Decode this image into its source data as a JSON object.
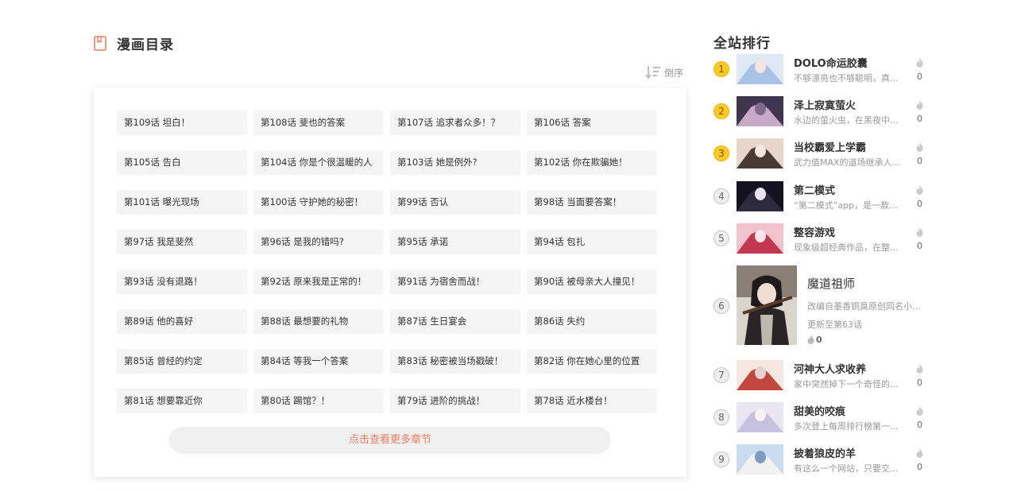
{
  "catalog": {
    "title": "漫画目录",
    "sort_label": "倒序",
    "more_label": "点击查看更多章节",
    "chapters": [
      "第109话 坦白！",
      "第108话 斐也的答案",
      "第107话 追求者众多！？",
      "第106话 答案",
      "第105话 告白",
      "第104话 你是个很温暖的人",
      "第103话 她是例外?",
      "第102话 你在欺骗她！",
      "第101话 曝光现场",
      "第100话 守护她的秘密！",
      "第99话 否认",
      "第98话 当面要答案！",
      "第97话 我是斐然",
      "第96话 是我的错吗?",
      "第95话 承诺",
      "第94话 包扎",
      "第93话 没有退路！",
      "第92话 原来我是正常的！",
      "第91话 为宿舍而战！",
      "第90话 被母亲大人撞见！",
      "第89话 他的喜好",
      "第88话 最想要的礼物",
      "第87话 生日宴会",
      "第86话 失约",
      "第85话 曾经的约定",
      "第84话 等我一个答案",
      "第83话 秘密被当场戳破！",
      "第82话 你在她心里的位置",
      "第81话 想要靠近你",
      "第80话 踢馆？！",
      "第79话 进阶的挑战！",
      "第78话 近水楼台！"
    ]
  },
  "ranking": {
    "title": "全站排行",
    "items": [
      {
        "rank": "1",
        "name": "DOLO命运胶囊",
        "desc": "不够漂亮也不够聪明，真...",
        "heat": "0"
      },
      {
        "rank": "2",
        "name": "泽上寂寞萤火",
        "desc": "水边的萤火虫，在黑夜中...",
        "heat": "0"
      },
      {
        "rank": "3",
        "name": "当校霸爱上学霸",
        "desc": "武力值MAX的道场继承人...",
        "heat": "0"
      },
      {
        "rank": "4",
        "name": "第二模式",
        "desc": "“第二模式”app，是一款...",
        "heat": "0"
      },
      {
        "rank": "5",
        "name": "整容游戏",
        "desc": "现象级超经典作品，在整...",
        "heat": "0"
      }
    ],
    "featured": {
      "rank": "6",
      "name": "魔道祖师",
      "desc": "改编自墨香铜臭原创同名小...",
      "update": "更新至第63话",
      "heat": "0"
    },
    "more_items": [
      {
        "rank": "7",
        "name": "河神大人求收养",
        "desc": "家中突然掉下一个奇怪的...",
        "heat": "0"
      },
      {
        "rank": "8",
        "name": "甜美的咬痕",
        "desc": "多次登上每周排行榜第一...",
        "heat": "0"
      },
      {
        "rank": "9",
        "name": "披着狼皮的羊",
        "desc": "有这么一个网站，只要交...",
        "heat": "0"
      }
    ]
  },
  "colors": {
    "accent": "#f07c5e",
    "gold_badge": "#ffc928",
    "grey_badge": "#eeeeee"
  }
}
